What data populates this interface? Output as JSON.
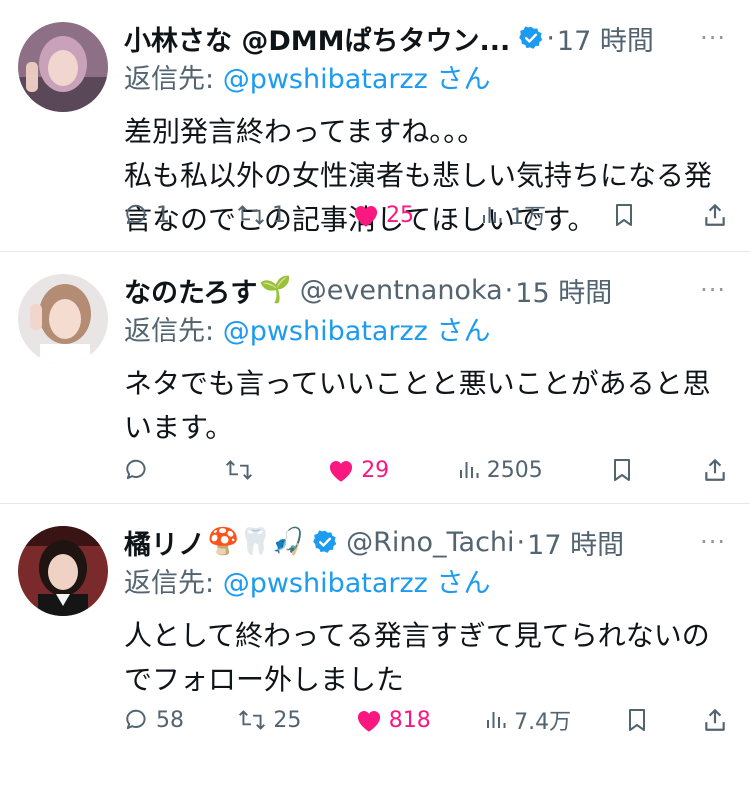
{
  "tweets": [
    {
      "name": "小林さな @DMMぱちタウン...",
      "verified": true,
      "handle": "",
      "dot": "·",
      "time": "17 時間",
      "reply_prefix": "返信先: ",
      "reply_to": "@pwshibatarzz",
      "reply_suffix": " さん",
      "text": "差別発言終わってますね。。。\n私も私以外の女性演者も悲しい気持ちになる発言なのでこの記事消してほしいです。",
      "replies": "1",
      "retweets": "1",
      "likes": "25",
      "views": "1万",
      "liked": true
    },
    {
      "name": "なのたろす",
      "name_emoji": "🌱",
      "handle": "@eventnanoka",
      "dot": "·",
      "time": "15 時間",
      "reply_prefix": "返信先: ",
      "reply_to": "@pwshibatarzz",
      "reply_suffix": " さん",
      "text": "ネタでも言っていいことと悪いことがあると思います。",
      "replies": "",
      "retweets": "",
      "likes": "29",
      "views": "2505",
      "liked": true
    },
    {
      "name": "橘リノ",
      "name_emoji": "🍄🦷🎣",
      "verified": true,
      "handle": "@Rino_Tachi",
      "dot": "·",
      "time": "17 時間",
      "reply_prefix": "返信先: ",
      "reply_to": "@pwshibatarzz",
      "reply_suffix": " さん",
      "text": "人として終わってる発言すぎて見てられないのでフォロー外しました",
      "replies": "58",
      "retweets": "25",
      "likes": "818",
      "views": "7.4万",
      "liked": true
    }
  ],
  "more_glyph": "···",
  "colors": {
    "link": "#1d9bf0",
    "like": "#f91880",
    "muted": "#536471",
    "verified": "#1d9bf0"
  },
  "icons": [
    "reply-icon",
    "retweet-icon",
    "like-icon",
    "views-icon",
    "bookmark-icon",
    "share-icon",
    "verified-badge-icon",
    "more-icon"
  ]
}
